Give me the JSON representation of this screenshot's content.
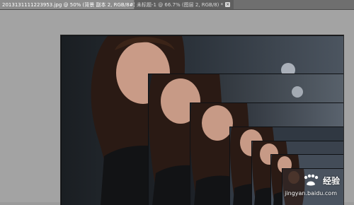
{
  "tabs": [
    {
      "label": "2013131111223953.jpg @ 50% (背景 副本 2, RGB/8#) *",
      "close": "×"
    },
    {
      "label": "未标题-1 @ 66.7% (图层 2, RGB/8) *",
      "close": "×"
    }
  ],
  "watermark": {
    "brand": "经验",
    "url": "jingyan.baidu.com"
  },
  "colors": {
    "workspace": "#a3a3a3",
    "tabbar": "#6f6f6f",
    "image_bg": "#1b1f24"
  }
}
